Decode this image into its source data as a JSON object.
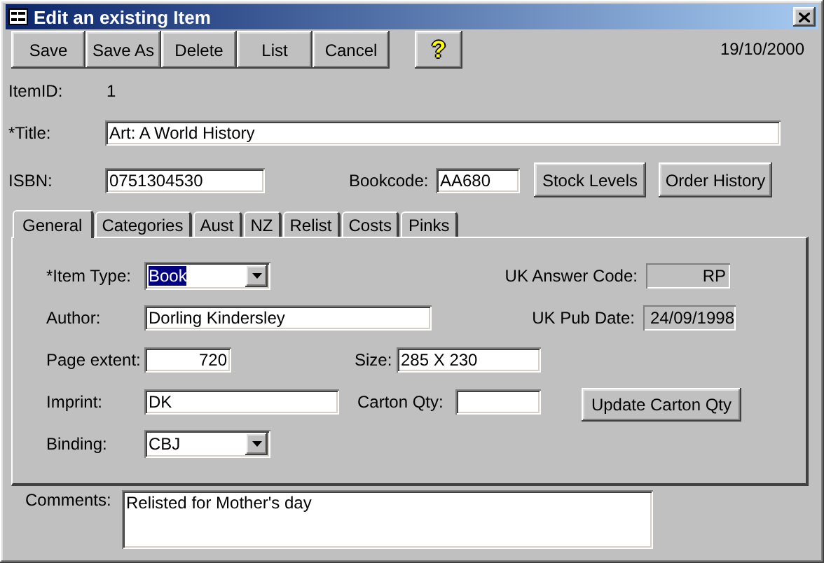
{
  "window": {
    "title": "Edit an existing Item"
  },
  "toolbar": {
    "buttons": [
      {
        "label": "Save"
      },
      {
        "label": "Save As"
      },
      {
        "label": "Delete"
      },
      {
        "label": "List"
      },
      {
        "label": "Cancel"
      }
    ],
    "help_glyph": "?",
    "date": "19/10/2000"
  },
  "item_id": {
    "label": "ItemID:",
    "value": "1"
  },
  "title_field": {
    "label": "*Title:",
    "value": "Art: A World History"
  },
  "isbn": {
    "label": "ISBN:",
    "value": "0751304530"
  },
  "bookcode": {
    "label": "Bookcode:",
    "value": "AA680"
  },
  "side_buttons": [
    {
      "label": "Stock Levels"
    },
    {
      "label": "Order History"
    }
  ],
  "tabs": [
    {
      "label": "General",
      "selected": true
    },
    {
      "label": "Categories",
      "selected": false
    },
    {
      "label": "Aust",
      "selected": false
    },
    {
      "label": "NZ",
      "selected": false
    },
    {
      "label": "Relist",
      "selected": false
    },
    {
      "label": "Costs",
      "selected": false
    },
    {
      "label": "Pinks",
      "selected": false
    }
  ],
  "general": {
    "item_type": {
      "label": "*Item Type:",
      "value": "Book",
      "kind": "combo",
      "text_selected": true
    },
    "uk_answer_code": {
      "label": "UK Answer Code:",
      "value": "RP",
      "kind": "locked"
    },
    "author": {
      "label": "Author:",
      "value": "Dorling Kindersley",
      "kind": "text"
    },
    "uk_pub_date": {
      "label": "UK Pub Date:",
      "value": "24/09/1998",
      "kind": "locked"
    },
    "page_extent": {
      "label": "Page extent:",
      "value": "720",
      "kind": "text"
    },
    "size": {
      "label": "Size:",
      "value": "285 X 230",
      "kind": "text"
    },
    "imprint": {
      "label": "Imprint:",
      "value": "DK",
      "kind": "text"
    },
    "carton_qty": {
      "label": "Carton Qty:",
      "kind": "text"
    },
    "update_button": {
      "label": "Update Carton Qty"
    },
    "binding": {
      "label": "Binding:",
      "value": "CBJ",
      "kind": "combo",
      "text_selected": false
    }
  },
  "comments": {
    "label": "Comments:",
    "value": "Relisted for Mother's day"
  }
}
